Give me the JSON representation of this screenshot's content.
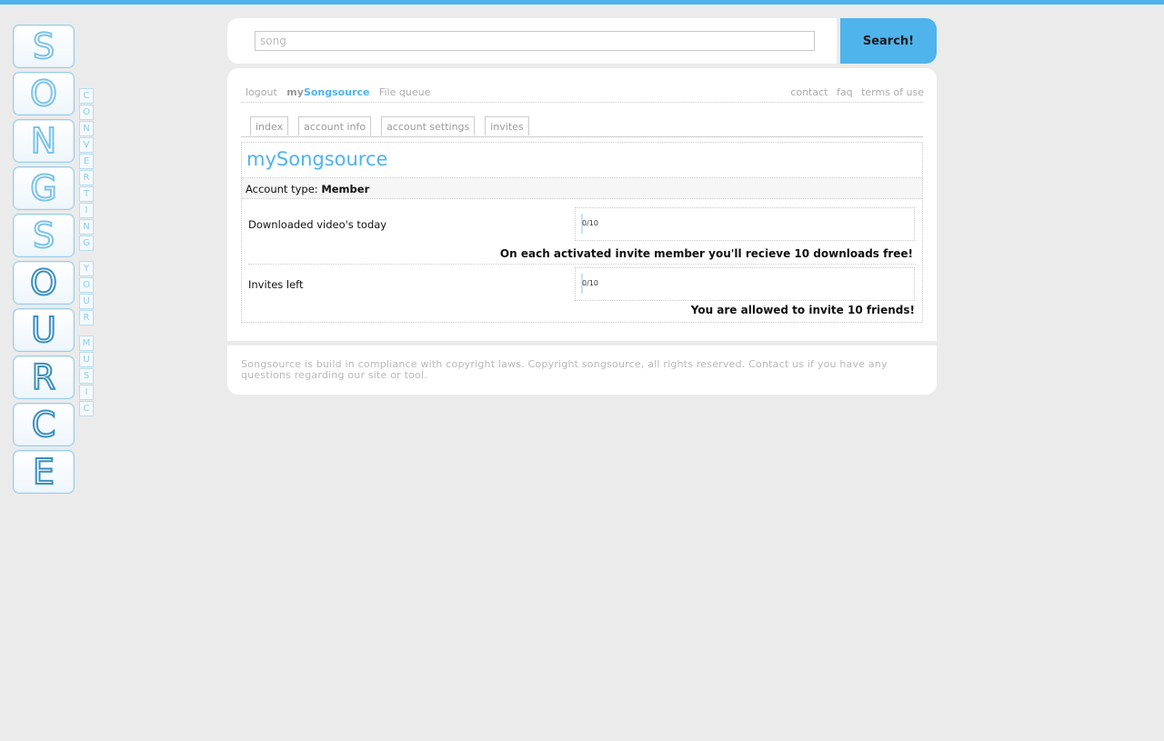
{
  "logo": {
    "letters": [
      "S",
      "O",
      "N",
      "G",
      "S",
      "O",
      "U",
      "R",
      "C",
      "E"
    ],
    "tagline_words": [
      [
        "C",
        "O",
        "N",
        "V",
        "E",
        "R",
        "T",
        "I",
        "N",
        "G"
      ],
      [
        "Y",
        "O",
        "U",
        "R"
      ],
      [
        "M",
        "U",
        "S",
        "I",
        "C"
      ]
    ]
  },
  "search": {
    "value": "song",
    "button_label": "Search!"
  },
  "nav": {
    "left": [
      {
        "label": "logout"
      },
      {
        "prefix": "my",
        "accent": "Songsource"
      },
      {
        "label": "File queue"
      }
    ],
    "right": [
      {
        "label": "contact"
      },
      {
        "label": "faq"
      },
      {
        "label": "terms of use"
      }
    ]
  },
  "tabs": [
    "index",
    "account info",
    "account settings",
    "invites"
  ],
  "page": {
    "title": "mySongsource",
    "account_type_label": "Account type:",
    "account_type_value": "Member",
    "downloads": {
      "label": "Downloaded video's today",
      "used": 0,
      "max": 10,
      "display": "0/10",
      "note": "On each activated invite member you'll recieve 10 downloads free!"
    },
    "invites": {
      "label": "Invites left",
      "used": 0,
      "max": 10,
      "display": "0/10",
      "note": "You are allowed to invite 10 friends!"
    }
  },
  "footer": {
    "text": "Songsource is build in compliance with copyright laws. Copyright songsource, all rights reserved. Contact us if you have any questions regarding our site or tool."
  },
  "colors": {
    "accent": "#4fb3ec",
    "background": "#ebebeb"
  }
}
